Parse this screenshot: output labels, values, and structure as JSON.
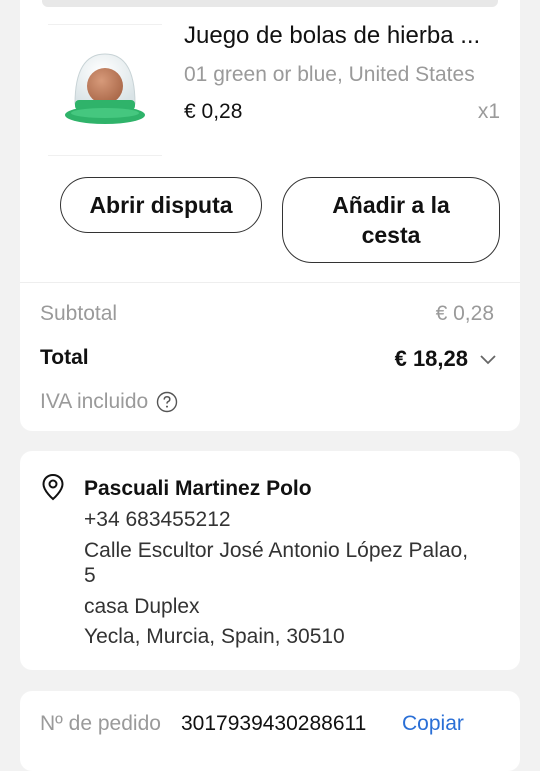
{
  "product": {
    "title": "Juego de bolas de hierba ...",
    "variant": "01 green or blue, United States",
    "price": "€ 0,28",
    "quantity": "x1",
    "image_icon": "catnip-ball-icon"
  },
  "actions": {
    "dispute_label": "Abrir disputa",
    "add_to_cart_label": "Añadir a la cesta"
  },
  "summary": {
    "subtotal_label": "Subtotal",
    "subtotal_value": "€ 0,28",
    "total_label": "Total",
    "total_value": "€ 18,28",
    "tax_note": "IVA incluido"
  },
  "address": {
    "name": "Pascuali Martinez Polo",
    "phone": "+34 683455212",
    "street_line1": "Calle Escultor José Antonio López Palao,",
    "street_line2": "5",
    "extra": "casa Duplex",
    "city": "Yecla, Murcia, Spain, 30510"
  },
  "order": {
    "number_label": "Nº de pedido",
    "number_value": "3017939430288611",
    "copy_label": "Copiar"
  },
  "colors": {
    "background": "#f2f2f2",
    "card": "#ffffff",
    "muted_text": "#9a9a9a",
    "link": "#2a6fd6",
    "product_green": "#2fb36a"
  }
}
